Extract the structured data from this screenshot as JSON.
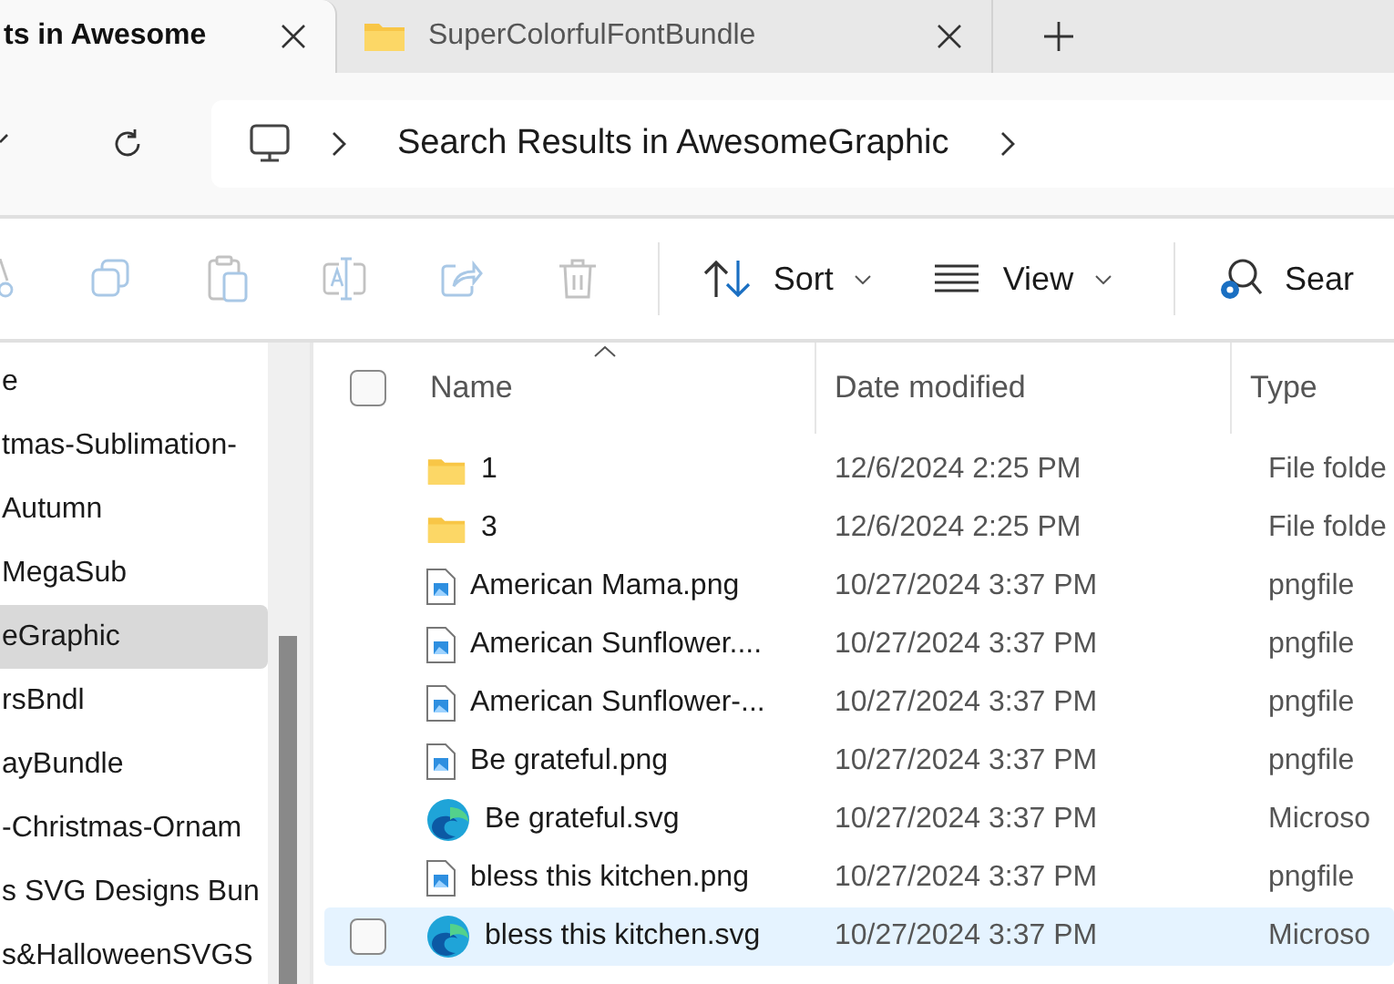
{
  "tabs": [
    {
      "label": "ts in Awesome",
      "selected": true
    },
    {
      "label": "SuperColorfulFontBundle",
      "selected": false
    }
  ],
  "address": {
    "crumb": "Search Results in AwesomeGraphic"
  },
  "toolbar": {
    "actions": [
      {
        "kind": "cut",
        "disabled": true
      },
      {
        "kind": "copy",
        "disabled": true
      },
      {
        "kind": "paste",
        "disabled": true
      },
      {
        "kind": "rename",
        "disabled": true
      },
      {
        "kind": "share",
        "disabled": true
      },
      {
        "kind": "delete",
        "disabled": true
      }
    ],
    "sort": "Sort",
    "view": "View",
    "search": "Sear"
  },
  "sidebar": {
    "items": [
      {
        "label": "e",
        "selected": false
      },
      {
        "label": "tmas-Sublimation-",
        "selected": false
      },
      {
        "label": "Autumn",
        "selected": false
      },
      {
        "label": "MegaSub",
        "selected": false
      },
      {
        "label": "eGraphic",
        "selected": true
      },
      {
        "label": "rsBndl",
        "selected": false
      },
      {
        "label": "ayBundle",
        "selected": false
      },
      {
        "label": "-Christmas-Ornam",
        "selected": false
      },
      {
        "label": "s SVG Designs Bun",
        "selected": false
      },
      {
        "label": "s&HalloweenSVGS",
        "selected": false
      }
    ]
  },
  "table": {
    "select_all": {
      "checked": false
    },
    "columns": [
      "Name",
      "Date modified",
      "Type"
    ],
    "rows": [
      {
        "kind": "folder",
        "name": "1",
        "date": "12/6/2024 2:25 PM",
        "type": "File folde",
        "selected": false
      },
      {
        "kind": "folder",
        "name": "3",
        "date": "12/6/2024 2:25 PM",
        "type": "File folde",
        "selected": false
      },
      {
        "kind": "image",
        "name": "American Mama.png",
        "date": "10/27/2024 3:37 PM",
        "type": "pngfile",
        "selected": false
      },
      {
        "kind": "image",
        "name": "American Sunflower....",
        "date": "10/27/2024 3:37 PM",
        "type": "pngfile",
        "selected": false
      },
      {
        "kind": "image",
        "name": "American Sunflower-...",
        "date": "10/27/2024 3:37 PM",
        "type": "pngfile",
        "selected": false
      },
      {
        "kind": "image",
        "name": "Be grateful.png",
        "date": "10/27/2024 3:37 PM",
        "type": "pngfile",
        "selected": false
      },
      {
        "kind": "edge",
        "name": "Be grateful.svg",
        "date": "10/27/2024 3:37 PM",
        "type": "Microso",
        "selected": false
      },
      {
        "kind": "image",
        "name": "bless this kitchen.png",
        "date": "10/27/2024 3:37 PM",
        "type": "pngfile",
        "selected": false
      },
      {
        "kind": "edge",
        "name": "bless this kitchen.svg",
        "date": "10/27/2024 3:37 PM",
        "type": "Microso",
        "selected": true
      }
    ]
  }
}
